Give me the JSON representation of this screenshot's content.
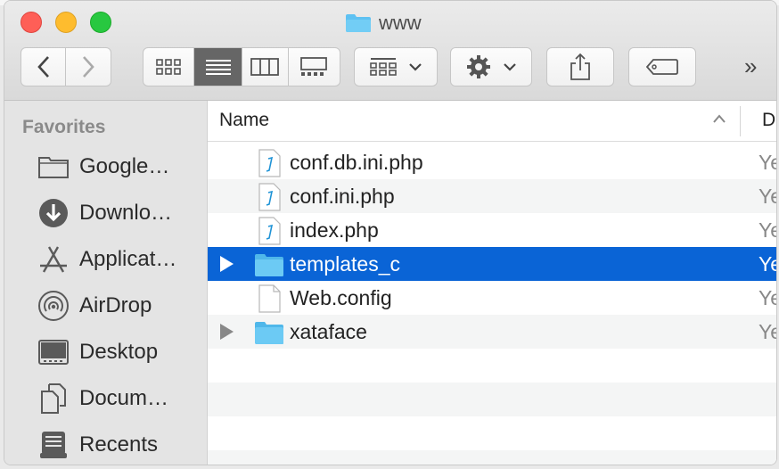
{
  "window": {
    "title": "www"
  },
  "toolbar": {
    "back": "back-button",
    "forward": "forward-button",
    "views": [
      "icon-view",
      "list-view",
      "column-view",
      "gallery-view"
    ],
    "active_view": "list-view",
    "more": "»"
  },
  "sidebar": {
    "header": "Favorites",
    "items": [
      {
        "label": "Google…",
        "icon": "folder-icon"
      },
      {
        "label": "Downlo…",
        "icon": "download-icon"
      },
      {
        "label": "Applicat…",
        "icon": "applications-icon"
      },
      {
        "label": "AirDrop",
        "icon": "airdrop-icon"
      },
      {
        "label": "Desktop",
        "icon": "desktop-icon"
      },
      {
        "label": "Docum…",
        "icon": "documents-icon"
      },
      {
        "label": "Recents",
        "icon": "recents-icon"
      }
    ]
  },
  "list": {
    "columns": {
      "name": "Name",
      "date": "D"
    },
    "rows": [
      {
        "name": "conf.db.ini.php",
        "date": "Ye",
        "type": "php",
        "selected": false
      },
      {
        "name": "conf.ini.php",
        "date": "Ye",
        "type": "php",
        "selected": false
      },
      {
        "name": "index.php",
        "date": "Ye",
        "type": "php",
        "selected": false
      },
      {
        "name": "templates_c",
        "date": "Ye",
        "type": "folder",
        "selected": true
      },
      {
        "name": "Web.config",
        "date": "Ye",
        "type": "file",
        "selected": false
      },
      {
        "name": "xataface",
        "date": "Ye",
        "type": "folder",
        "selected": false
      }
    ]
  },
  "colors": {
    "selection": "#0a64d6",
    "folder": "#5ec1f2",
    "accent_red": "#fe5f57",
    "accent_yellow": "#febc2e",
    "accent_green": "#28c840"
  }
}
